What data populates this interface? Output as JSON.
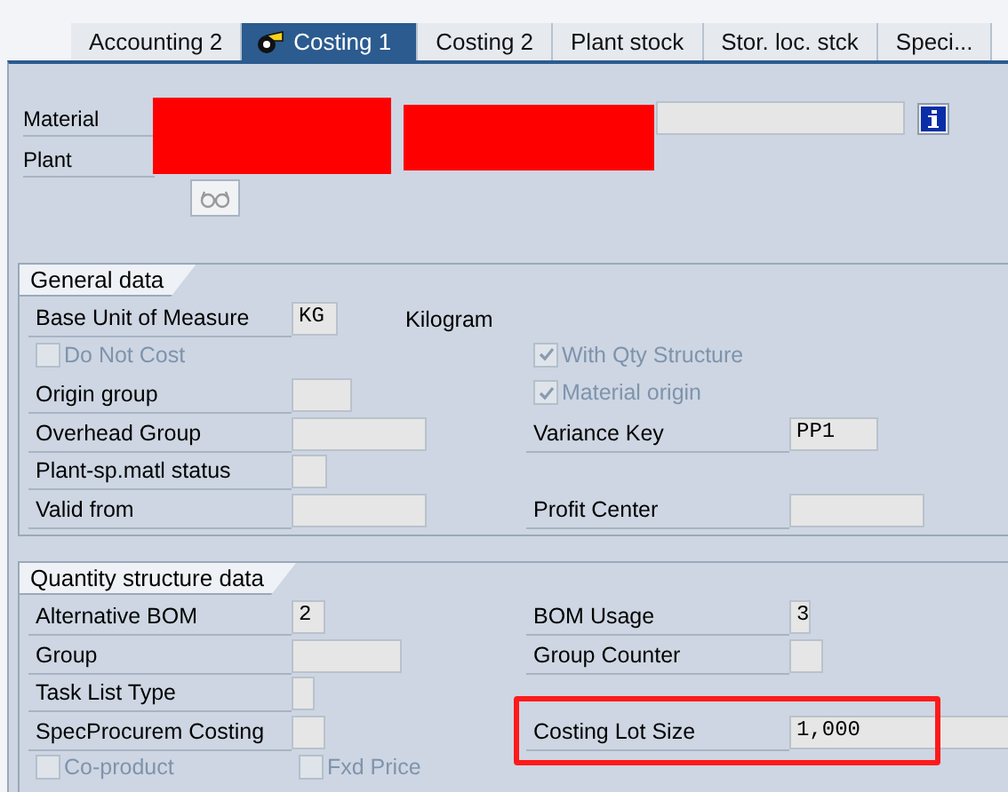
{
  "tabs": [
    {
      "label": "Accounting 2",
      "selected": false
    },
    {
      "label": "Costing 1",
      "selected": true
    },
    {
      "label": "Costing 2",
      "selected": false
    },
    {
      "label": "Plant stock",
      "selected": false
    },
    {
      "label": "Stor. loc. stck",
      "selected": false
    },
    {
      "label": "Speci...",
      "selected": false
    }
  ],
  "header": {
    "material_label": "Material",
    "plant_label": "Plant"
  },
  "sections": [
    {
      "title": "General data",
      "rows": [
        [
          {
            "kind": "field",
            "label": "Base Unit of Measure",
            "value": "KG",
            "description": "Kilogram"
          }
        ],
        [
          {
            "kind": "checkbox",
            "label": "Do Not Cost",
            "checked": false,
            "disabled": true
          },
          {
            "kind": "gap"
          },
          {
            "kind": "checkbox",
            "label": "With Qty Structure",
            "checked": true,
            "disabled": true
          }
        ],
        [
          {
            "kind": "field",
            "label": "Origin group"
          },
          {
            "kind": "checkbox",
            "label": "Material origin",
            "checked": true,
            "disabled": true
          }
        ],
        [
          {
            "kind": "field",
            "label": "Overhead Group"
          },
          {
            "kind": "field",
            "label": "Variance Key",
            "value": "PP1"
          }
        ],
        [
          {
            "kind": "field",
            "label": "Plant-sp.matl status"
          }
        ],
        [
          {
            "kind": "field",
            "label": "Valid from"
          },
          {
            "kind": "field",
            "label": "Profit Center"
          }
        ]
      ]
    },
    {
      "title": "Quantity structure data",
      "rows": [
        [
          {
            "kind": "field",
            "label": "Alternative BOM",
            "value": "2"
          },
          {
            "kind": "field",
            "label": "BOM Usage",
            "value": "3"
          }
        ],
        [
          {
            "kind": "field",
            "label": "Group"
          },
          {
            "kind": "field",
            "label": "Group Counter"
          }
        ],
        [
          {
            "kind": "field",
            "label": "Task List Type"
          }
        ],
        [
          {
            "kind": "field",
            "label": "SpecProcurem Costing"
          },
          {
            "kind": "field",
            "label": "Costing Lot Size",
            "value": "1,000",
            "highlighted": true
          }
        ],
        [
          {
            "kind": "checkbox",
            "label": "Co-product",
            "checked": false,
            "disabled": true
          },
          {
            "kind": "checkbox",
            "label": "Fxd Price",
            "checked": false,
            "disabled": true
          }
        ]
      ]
    }
  ]
}
